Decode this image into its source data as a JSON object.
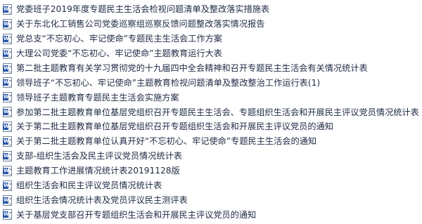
{
  "files": [
    {
      "name": "党委班子2019年度专题民主生活会检视问题清单及整改落实措施表",
      "icon": "word-document-icon"
    },
    {
      "name": "关于东北化工销售公司党委巡察组巡察反馈问题整改落实情况报告",
      "icon": "word-document-icon"
    },
    {
      "name": "党总支“不忘初心、牢记使命”专题民主生活会工作方案",
      "icon": "word-document-icon"
    },
    {
      "name": "大理公司党委“不忘初心、牢记使命”主题教育运行大表",
      "icon": "word-document-icon"
    },
    {
      "name": "第二批主题教育有关学习贯彻党的十九届四中全会精神和召开专题民主生活会有关情况统计表",
      "icon": "word-document-icon"
    },
    {
      "name": "领导班子“不忘初心、牢记使命”主题教育检视问题清单及整改整治工作运行表(1)",
      "icon": "word-document-icon"
    },
    {
      "name": "领导班子主题教育专题民主生活会实施方案",
      "icon": "word-document-icon"
    },
    {
      "name": "参加第二批主题教育单位基层党组织召开专题民主生活会、专题组织生活会和开展民主评议党员情况统计表",
      "icon": "word-document-icon"
    },
    {
      "name": "关于第二批主题教育单位基层党组织召开专题组织生活会和开展民主评议党员的通知",
      "icon": "word-document-icon"
    },
    {
      "name": "关于第二批主题教育单位认真开好“不忘初心、牢记使命”专题民主生活会的通知",
      "icon": "word-document-icon"
    },
    {
      "name": "支部-组织生活会及民主评议党员情况统计表",
      "icon": "word-document-icon"
    },
    {
      "name": "主题教育工作进展情况统计表20191128版",
      "icon": "word-document-icon"
    },
    {
      "name": "组织生活会和民主评议党员情况统计表",
      "icon": "word-document-icon"
    },
    {
      "name": "组织生活会情况统计表及党员评议民主测评表",
      "icon": "word-document-icon"
    },
    {
      "name": "关于基层党支部召开专题组织生活会和开展民主评议党员的通知",
      "icon": "word-document-icon"
    }
  ]
}
